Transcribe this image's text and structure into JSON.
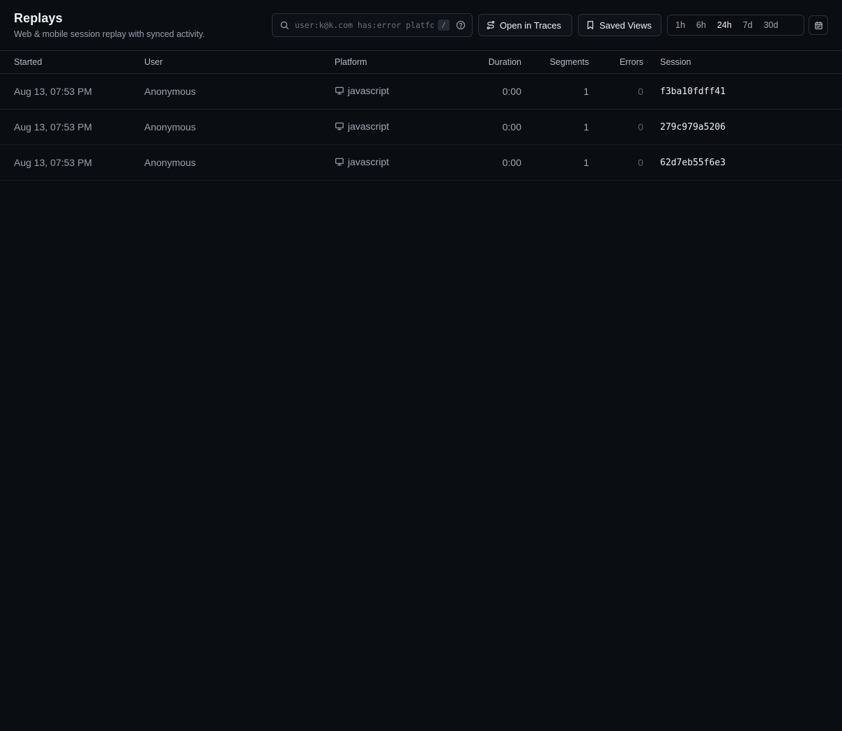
{
  "page": {
    "title": "Replays",
    "subtitle": "Web & mobile session replay with synced activity."
  },
  "search": {
    "placeholder": "user:k@k.com has:error platform:javascript",
    "value": "",
    "shortcut": "/",
    "icon": "search-icon",
    "help_icon": "help-circle-icon"
  },
  "toolbar": {
    "open_traces_label": "Open in Traces",
    "open_traces_icon": "traces-icon",
    "saved_views_label": "Saved Views",
    "saved_views_icon": "bookmark-icon",
    "time_ranges": [
      "1h",
      "6h",
      "24h",
      "7d",
      "30d"
    ],
    "active_range": "24h",
    "calendar_icon": "calendar-icon"
  },
  "table": {
    "columns": {
      "started": "Started",
      "user": "User",
      "platform": "Platform",
      "duration": "Duration",
      "segments": "Segments",
      "errors": "Errors",
      "session": "Session"
    },
    "rows": [
      {
        "started": "Aug 13, 07:53 PM",
        "user": "Anonymous",
        "platform": "javascript",
        "platform_icon": "monitor-icon",
        "duration": "0:00",
        "segments": "1",
        "errors": "0",
        "session": "f3ba10fdff41"
      },
      {
        "started": "Aug 13, 07:53 PM",
        "user": "Anonymous",
        "platform": "javascript",
        "platform_icon": "monitor-icon",
        "duration": "0:00",
        "segments": "1",
        "errors": "0",
        "session": "279c979a5206"
      },
      {
        "started": "Aug 13, 07:53 PM",
        "user": "Anonymous",
        "platform": "javascript",
        "platform_icon": "monitor-icon",
        "duration": "0:00",
        "segments": "1",
        "errors": "0",
        "session": "62d7eb55f6e3"
      }
    ]
  },
  "colors": {
    "background": "#0a0d12",
    "border": "#2c313a",
    "text_primary": "#eef0f3",
    "text_muted": "#9ba1ab"
  }
}
